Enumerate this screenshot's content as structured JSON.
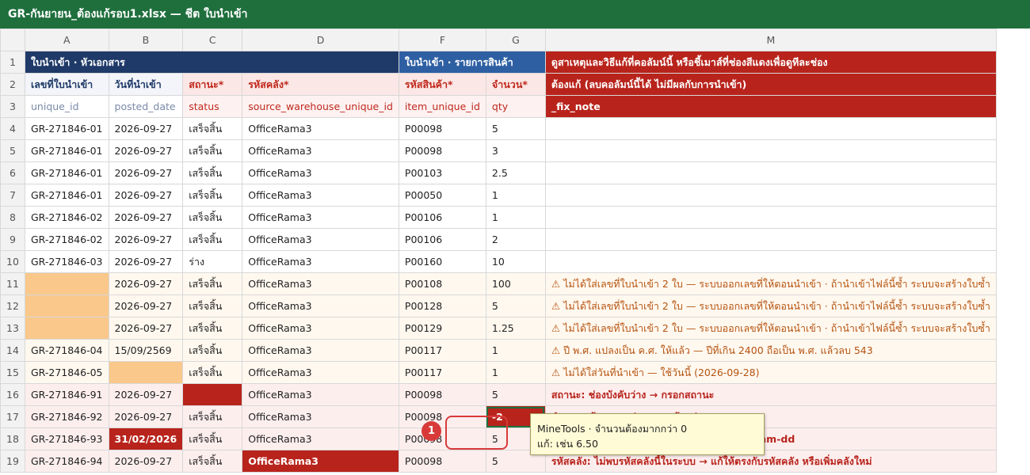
{
  "window": {
    "title": "GR-กันยายน_ต้องแก้รอบ1.xlsx — ชีต ใบนำเข้า"
  },
  "columns": [
    "A",
    "B",
    "C",
    "D",
    "F",
    "G",
    "M"
  ],
  "section_headers": {
    "doc": "ใบนำเข้า · หัวเอกสาร",
    "items": "ใบนำเข้า · รายการสินค้า",
    "notes": "ดูสาเหตุและวิธีแก้ที่คอลัมน์นี้ หรือชี้เมาส์ที่ช่องสีแดงเพื่อดูทีละช่อง"
  },
  "labels": [
    "เลขที่ใบนำเข้า",
    "วันที่นำเข้า",
    "สถานะ*",
    "รหัสคลัง*",
    "รหัสสินค้า*",
    "จำนวน*",
    "ต้องแก้ (ลบคอลัมน์นี้ได้ ไม่มีผลกับการนำเข้า)"
  ],
  "keys": [
    "unique_id",
    "posted_date",
    "status",
    "source_warehouse_unique_id",
    "item_unique_id",
    "qty",
    "_fix_note"
  ],
  "rows": [
    {
      "n": "4",
      "a": "GR-271846-01",
      "b": "2026-09-27",
      "c": "เสร็จสิ้น",
      "d": "OfficeRama3",
      "f": "P00098",
      "g": "5",
      "m": ""
    },
    {
      "n": "5",
      "a": "GR-271846-01",
      "b": "2026-09-27",
      "c": "เสร็จสิ้น",
      "d": "OfficeRama3",
      "f": "P00098",
      "g": "3",
      "m": ""
    },
    {
      "n": "6",
      "a": "GR-271846-01",
      "b": "2026-09-27",
      "c": "เสร็จสิ้น",
      "d": "OfficeRama3",
      "f": "P00103",
      "g": "2.5",
      "m": ""
    },
    {
      "n": "7",
      "a": "GR-271846-01",
      "b": "2026-09-27",
      "c": "เสร็จสิ้น",
      "d": "OfficeRama3",
      "f": "P00050",
      "g": "1",
      "m": ""
    },
    {
      "n": "8",
      "a": "GR-271846-02",
      "b": "2026-09-27",
      "c": "เสร็จสิ้น",
      "d": "OfficeRama3",
      "f": "P00106",
      "g": "1",
      "m": ""
    },
    {
      "n": "9",
      "a": "GR-271846-02",
      "b": "2026-09-27",
      "c": "เสร็จสิ้น",
      "d": "OfficeRama3",
      "f": "P00106",
      "g": "2",
      "m": ""
    },
    {
      "n": "10",
      "a": "GR-271846-03",
      "b": "2026-09-27",
      "c": "ร่าง",
      "d": "OfficeRama3",
      "f": "P00160",
      "g": "10",
      "m": ""
    },
    {
      "n": "11",
      "a": "",
      "b": "2026-09-27",
      "c": "เสร็จสิ้น",
      "d": "OfficeRama3",
      "f": "P00108",
      "g": "100",
      "m": "⚠ ไม่ได้ใส่เลขที่ใบนำเข้า 2 ใบ — ระบบออกเลขที่ให้ตอนนำเข้า · ถ้านำเข้าไฟล์นี้ซ้ำ ระบบจะสร้างใบซ้ำ"
    },
    {
      "n": "12",
      "a": "",
      "b": "2026-09-27",
      "c": "เสร็จสิ้น",
      "d": "OfficeRama3",
      "f": "P00128",
      "g": "5",
      "m": "⚠ ไม่ได้ใส่เลขที่ใบนำเข้า 2 ใบ — ระบบออกเลขที่ให้ตอนนำเข้า · ถ้านำเข้าไฟล์นี้ซ้ำ ระบบจะสร้างใบซ้ำ"
    },
    {
      "n": "13",
      "a": "",
      "b": "2026-09-27",
      "c": "เสร็จสิ้น",
      "d": "OfficeRama3",
      "f": "P00129",
      "g": "1.25",
      "m": "⚠ ไม่ได้ใส่เลขที่ใบนำเข้า 2 ใบ — ระบบออกเลขที่ให้ตอนนำเข้า · ถ้านำเข้าไฟล์นี้ซ้ำ ระบบจะสร้างใบซ้ำ"
    },
    {
      "n": "14",
      "a": "GR-271846-04",
      "b": "15/09/2569",
      "c": "เสร็จสิ้น",
      "d": "OfficeRama3",
      "f": "P00117",
      "g": "1",
      "m": "⚠ ปี พ.ศ. แปลงเป็น ค.ศ. ให้แล้ว — ปีที่เกิน 2400 ถือเป็น พ.ศ. แล้วลบ 543"
    },
    {
      "n": "15",
      "a": "GR-271846-05",
      "b": "",
      "c": "เสร็จสิ้น",
      "d": "OfficeRama3",
      "f": "P00117",
      "g": "1",
      "m": "⚠ ไม่ได้ใส่วันที่นำเข้า — ใช้วันนี้ (2026-09-28)"
    },
    {
      "n": "16",
      "a": "GR-271846-91",
      "b": "2026-09-27",
      "c": "",
      "d": "OfficeRama3",
      "f": "P00098",
      "g": "5",
      "m": "สถานะ: ช่องบังคับว่าง → กรอกสถานะ"
    },
    {
      "n": "17",
      "a": "GR-271846-92",
      "b": "2026-09-27",
      "c": "เสร็จสิ้น",
      "d": "OfficeRama3",
      "f": "P00098",
      "g": "-2",
      "m": "จำนวน: ต้องมากกว่า 0 → แก้: เช่น 6.50"
    },
    {
      "n": "18",
      "a": "GR-271846-93",
      "b": "31/02/2026",
      "c": "เสร็จสิ้น",
      "d": "OfficeRama3",
      "f": "P00098",
      "g": "5",
      "m": "วันที่นำเข้า: วันที่ไม่ถูกต้อง → ใช้รูปแบบ yyyy-mm-dd"
    },
    {
      "n": "19",
      "a": "GR-271846-94",
      "b": "2026-09-27",
      "c": "เสร็จสิ้น",
      "d": "OfficeRama3",
      "f": "P00098",
      "g": "5",
      "m": "รหัสคลัง: ไม่พบรหัสคลังนี้ในระบบ → แก้ให้ตรงกับรหัสคลัง หรือเพิ่มคลังใหม่"
    }
  ],
  "tooltip": {
    "line1": "MineTools · จำนวนต้องมากกว่า 0",
    "line2": "แก้: เช่น 6.50"
  },
  "badge": "1",
  "colors": {
    "titlebar": "#1f6f3d",
    "navy": "#1f3a68",
    "blue": "#2e5fa3",
    "red": "#b8241c",
    "orange_fill": "#f9c88a"
  }
}
